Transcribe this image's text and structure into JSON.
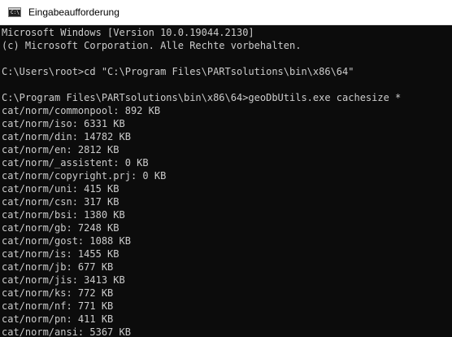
{
  "window": {
    "title": "Eingabeaufforderung",
    "icon_glyph": "C:\\",
    "icon": "cmd-icon"
  },
  "console": {
    "lines": [
      "Microsoft Windows [Version 10.0.19044.2130]",
      "(c) Microsoft Corporation. Alle Rechte vorbehalten.",
      "",
      "C:\\Users\\root>cd \"C:\\Program Files\\PARTsolutions\\bin\\x86\\64\"",
      "",
      "C:\\Program Files\\PARTsolutions\\bin\\x86\\64>geoDbUtils.exe cachesize *",
      "cat/norm/commonpool: 892 KB",
      "cat/norm/iso: 6331 KB",
      "cat/norm/din: 14782 KB",
      "cat/norm/en: 2812 KB",
      "cat/norm/_assistent: 0 KB",
      "cat/norm/copyright.prj: 0 KB",
      "cat/norm/uni: 415 KB",
      "cat/norm/csn: 317 KB",
      "cat/norm/bsi: 1380 KB",
      "cat/norm/gb: 7248 KB",
      "cat/norm/gost: 1088 KB",
      "cat/norm/is: 1455 KB",
      "cat/norm/jb: 677 KB",
      "cat/norm/jis: 3413 KB",
      "cat/norm/ks: 772 KB",
      "cat/norm/nf: 771 KB",
      "cat/norm/pn: 411 KB",
      "cat/norm/ansi: 5367 KB"
    ]
  },
  "colors": {
    "console_background": "#0c0c0c",
    "console_text": "#cccccc",
    "titlebar_background": "#ffffff"
  }
}
